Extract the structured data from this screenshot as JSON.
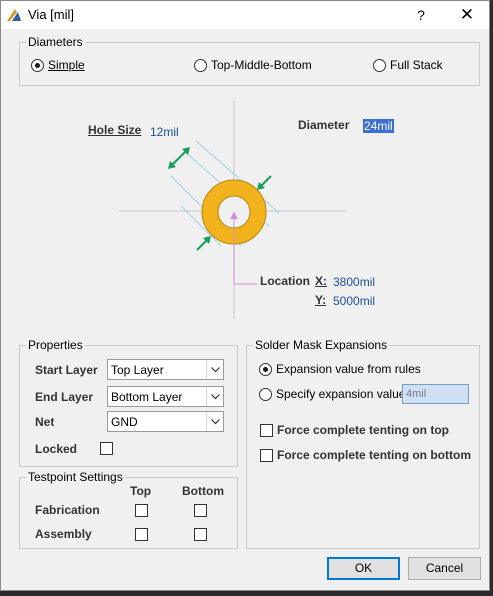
{
  "window": {
    "title": "Via [mil]",
    "help_glyph": "?",
    "close_glyph": "✕"
  },
  "diameters": {
    "title": "Diameters",
    "options": [
      "Simple",
      "Top-Middle-Bottom",
      "Full Stack"
    ],
    "selected": "Simple"
  },
  "diagram": {
    "hole_size_label": "Hole Size",
    "hole_size_value": "12mil",
    "diameter_label": "Diameter",
    "diameter_value": "24mil",
    "location_label": "Location",
    "x_label": "X:",
    "x_value": "3800mil",
    "y_label": "Y:",
    "y_value": "5000mil",
    "pad_color": "#f2b21b",
    "arrow_color": "#17a05a"
  },
  "properties": {
    "title": "Properties",
    "start_layer_label": "Start Layer",
    "start_layer_value": "Top Layer",
    "end_layer_label": "End Layer",
    "end_layer_value": "Bottom Layer",
    "net_label": "Net",
    "net_value": "GND",
    "locked_label": "Locked"
  },
  "testpoint": {
    "title": "Testpoint Settings",
    "col_top": "Top",
    "col_bottom": "Bottom",
    "fabrication_label": "Fabrication",
    "assembly_label": "Assembly"
  },
  "solder_mask": {
    "title": "Solder Mask Expansions",
    "option_rules": "Expansion value from rules",
    "option_specify": "Specify expansion value",
    "specify_value": "4mil",
    "tent_top": "Force complete tenting on top",
    "tent_bottom": "Force complete tenting on bottom"
  },
  "buttons": {
    "ok": "OK",
    "cancel": "Cancel"
  }
}
